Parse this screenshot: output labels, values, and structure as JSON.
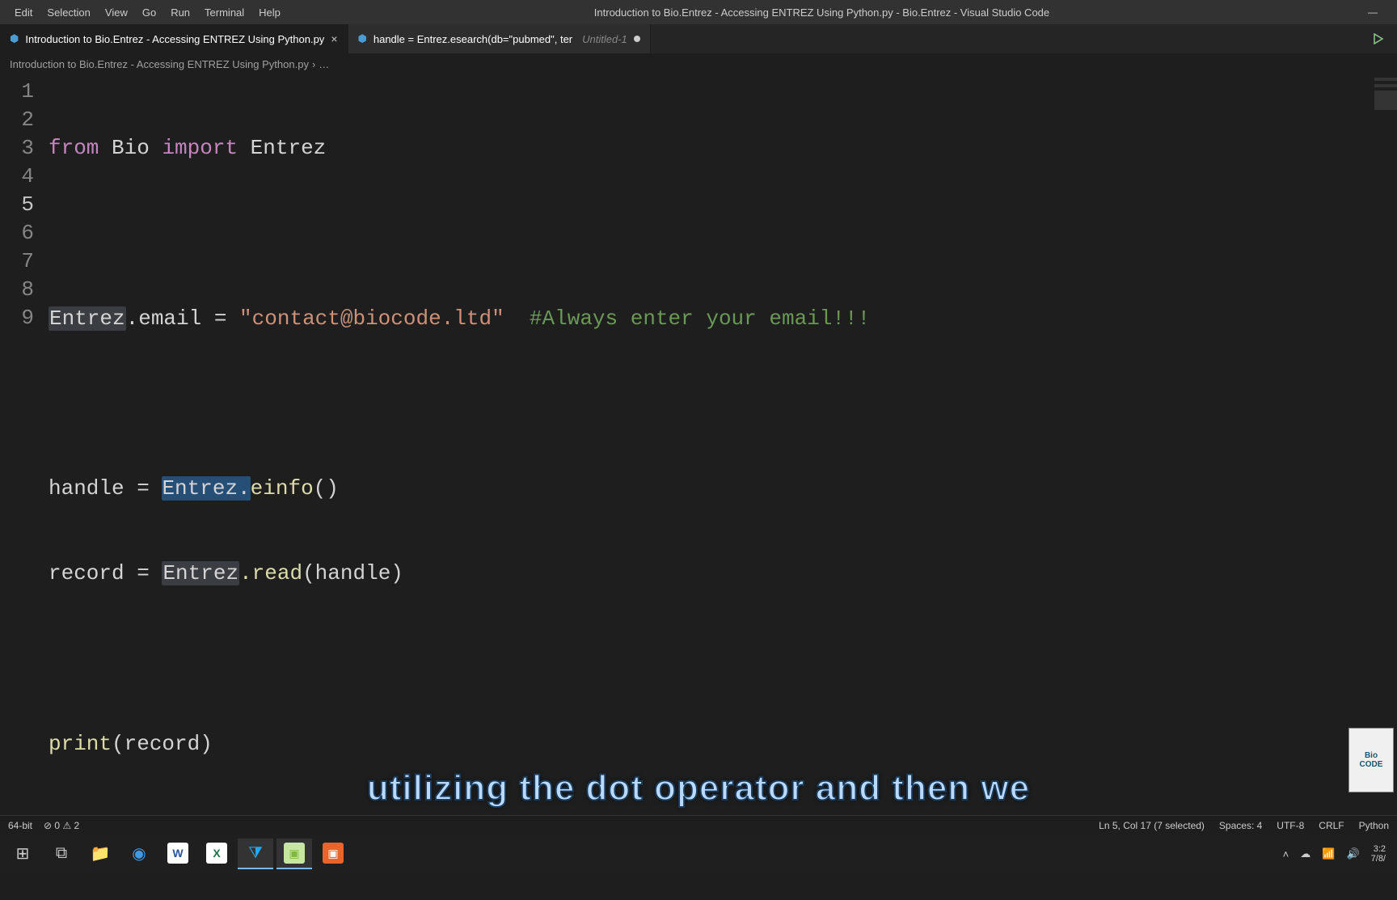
{
  "menu": {
    "edit": "Edit",
    "selection": "Selection",
    "view": "View",
    "go": "Go",
    "run": "Run",
    "terminal": "Terminal",
    "help": "Help"
  },
  "window": {
    "title": "Introduction to Bio.Entrez - Accessing ENTREZ Using Python.py - Bio.Entrez - Visual Studio Code"
  },
  "tabs": {
    "tab1": {
      "icon": "python-icon",
      "label": "Introduction to Bio.Entrez - Accessing ENTREZ Using Python.py"
    },
    "tab2": {
      "icon": "python-icon",
      "label": "handle = Entrez.esearch(db=\"pubmed\", ter",
      "untitled": "Untitled-1"
    }
  },
  "breadcrumb": {
    "file": "Introduction to Bio.Entrez - Accessing ENTREZ Using Python.py",
    "sep": "›",
    "more": "…"
  },
  "code": {
    "l1_from": "from",
    "l1_bio": " Bio ",
    "l1_import": "import",
    "l1_entrez": " Entrez",
    "l3_entrez": "Entrez",
    "l3_email": ".email ",
    "l3_eq": "=",
    "l3_str": " \"contact@biocode.ltd\" ",
    "l3_cmt": " #Always enter your email!!!",
    "l5_handle": "handle ",
    "l5_eq": "=",
    "l5_sp": " ",
    "l5_entrez_sel": "Entrez.",
    "l5_einfo": "einfo",
    "l5_paren": "()",
    "l6_record": "record ",
    "l6_eq": "=",
    "l6_sp": " ",
    "l6_entrez": "Entrez",
    "l6_read": ".read",
    "l6_arg": "(handle)",
    "l8_print": "print",
    "l8_arg": "(record)",
    "ln1": "1",
    "ln2": "2",
    "ln3": "3",
    "ln4": "4",
    "ln5": "5",
    "ln6": "6",
    "ln7": "7",
    "ln8": "8",
    "ln9": "9"
  },
  "caption": "utilizing the dot operator and then we",
  "logo": {
    "line1": "Bio",
    "line2": "CODE"
  },
  "status": {
    "arch": "64-bit",
    "errors": "0",
    "warnings": "2",
    "pos": "Ln 5, Col 17 (7 selected)",
    "spaces": "Spaces: 4",
    "enc": "UTF-8",
    "eol": "CRLF",
    "lang": "Python"
  },
  "tray": {
    "time": "3:2",
    "date": "7/8/"
  }
}
